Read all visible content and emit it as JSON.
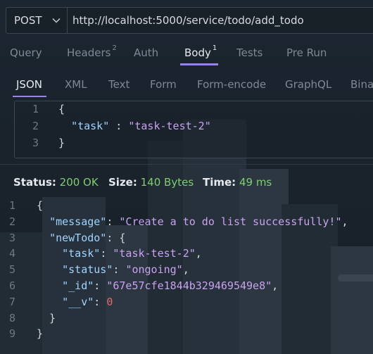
{
  "request": {
    "method": "POST",
    "url": "http://localhost:5000/service/todo/add_todo"
  },
  "tabs": [
    {
      "label": "Query",
      "badge": ""
    },
    {
      "label": "Headers",
      "badge": "2"
    },
    {
      "label": "Auth",
      "badge": ""
    },
    {
      "label": "Body",
      "badge": "1"
    },
    {
      "label": "Tests",
      "badge": ""
    },
    {
      "label": "Pre Run",
      "badge": ""
    }
  ],
  "active_tab": "Body",
  "body_types": [
    "JSON",
    "XML",
    "Text",
    "Form",
    "Form-encode",
    "GraphQL",
    "Binary"
  ],
  "active_body_type": "JSON",
  "request_body": {
    "line_numbers": [
      "1",
      "2",
      "3"
    ],
    "lines": [
      "{",
      "  \"task\" : \"task-test-2\"",
      "}"
    ]
  },
  "status": {
    "status_label": "Status:",
    "status_value": "200 OK",
    "size_label": "Size:",
    "size_value": "140 Bytes",
    "time_label": "Time:",
    "time_value": "49 ms"
  },
  "response": {
    "line_numbers": [
      "1",
      "2",
      "3",
      "4",
      "5",
      "6",
      "7",
      "8",
      "9"
    ],
    "lines": [
      "{",
      "  \"message\": \"Create a to do list successfully!\",",
      "  \"newTodo\": {",
      "    \"task\": \"task-test-2\",",
      "    \"status\": \"ongoing\",",
      "    \"_id\": \"67e57cfe1844b329469549e8\",",
      "    \"__v\": 0",
      "  }",
      "}"
    ]
  },
  "colors": {
    "accent": "#9b84e0",
    "ok": "#7ccf6e",
    "json_key": "#9fd4ff",
    "json_string": "#c9a2f0",
    "json_number": "#e06b6b"
  }
}
